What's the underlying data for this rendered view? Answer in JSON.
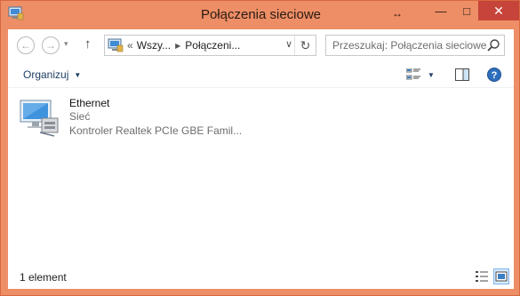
{
  "window": {
    "title": "Połączenia sieciowe",
    "controls": {
      "resize": "↔",
      "minimize": "—",
      "maximize": "□",
      "close": "✕"
    }
  },
  "navigation": {
    "back": "←",
    "forward": "→",
    "recent": "▾",
    "up": "↑",
    "address_prefix": "«",
    "address_segment_1": "Wszy...",
    "address_segment_2": "Połączeni...",
    "address_dropdown": "∨",
    "refresh": "↻",
    "search_placeholder": "Przeszukaj: Połączenia sieciowe"
  },
  "toolbar": {
    "organize_label": "Organizuj",
    "dropdown_arrow": "▼"
  },
  "items": [
    {
      "name": "Ethernet",
      "type": "Sieć",
      "adapter": "Kontroler Realtek PCIe GBE Famil..."
    }
  ],
  "status": {
    "count_text": "1 element"
  },
  "colors": {
    "title_bar": "#ed8e66",
    "close_button": "#c7443a",
    "accent_blue": "#1e3e64"
  },
  "icons": [
    "network-connections-icon",
    "search-icon",
    "change-view-icon",
    "preview-pane-icon",
    "help-icon",
    "network-adapter-icon",
    "details-view-icon",
    "large-icons-view-icon"
  ]
}
